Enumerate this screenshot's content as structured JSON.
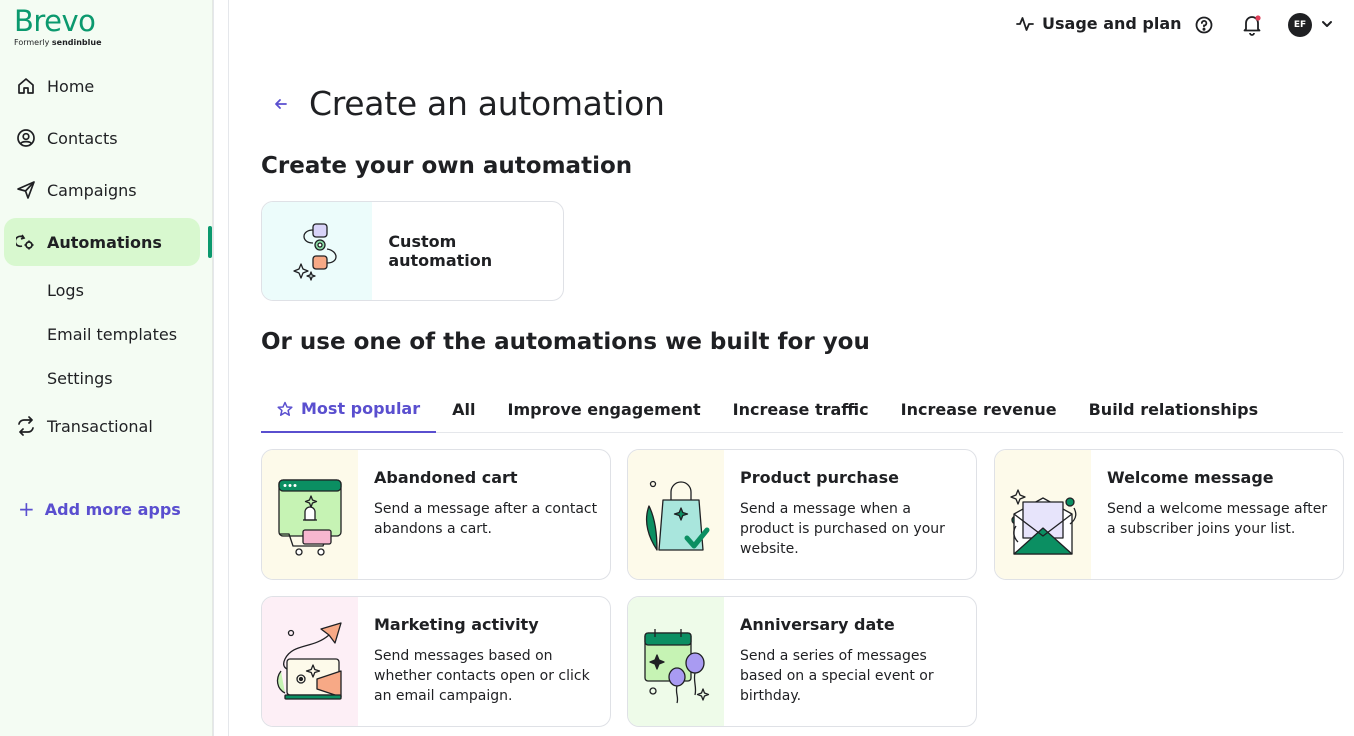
{
  "brand": {
    "name": "Brevo",
    "formerly_prefix": "Formerly",
    "formerly_name": "sendinblue",
    "color": "#0b996e"
  },
  "sidebar": {
    "items": [
      {
        "label": "Home",
        "icon": "home-icon"
      },
      {
        "label": "Contacts",
        "icon": "contacts-icon"
      },
      {
        "label": "Campaigns",
        "icon": "send-icon"
      },
      {
        "label": "Automations",
        "icon": "automation-icon",
        "active": true
      },
      {
        "label": "Transactional",
        "icon": "transactional-icon"
      }
    ],
    "subitems": [
      {
        "label": "Logs"
      },
      {
        "label": "Email templates"
      },
      {
        "label": "Settings"
      }
    ],
    "add_apps": "Add more apps"
  },
  "topbar": {
    "usage": "Usage and plan",
    "avatar_initials": "EF"
  },
  "page": {
    "title": "Create an automation",
    "own_heading": "Create your own automation",
    "custom_card": "Custom automation",
    "builtin_heading": "Or use one of the automations we built for you",
    "tabs": [
      "Most popular",
      "All",
      "Improve engagement",
      "Increase traffic",
      "Increase revenue",
      "Build relationships"
    ],
    "cards": [
      {
        "title": "Abandoned cart",
        "desc": "Send a message after a contact abandons a cart.",
        "bg": "#fdfaea"
      },
      {
        "title": "Product purchase",
        "desc": "Send a message when a product is purchased on your website.",
        "bg": "#fdfaea"
      },
      {
        "title": "Welcome message",
        "desc": "Send a welcome message after a subscriber joins your list.",
        "bg": "#fdfaea"
      },
      {
        "title": "Marketing activity",
        "desc": "Send messages based on whether contacts open or click an email campaign.",
        "bg": "#fdeff6"
      },
      {
        "title": "Anniversary date",
        "desc": "Send a series of messages based on a special event or birthday.",
        "bg": "#eefbe9"
      }
    ]
  },
  "colors": {
    "accent": "#5a4fcf",
    "active_nav_bg": "#d8f8cf",
    "sidebar_bg": "#f4fcf3"
  }
}
